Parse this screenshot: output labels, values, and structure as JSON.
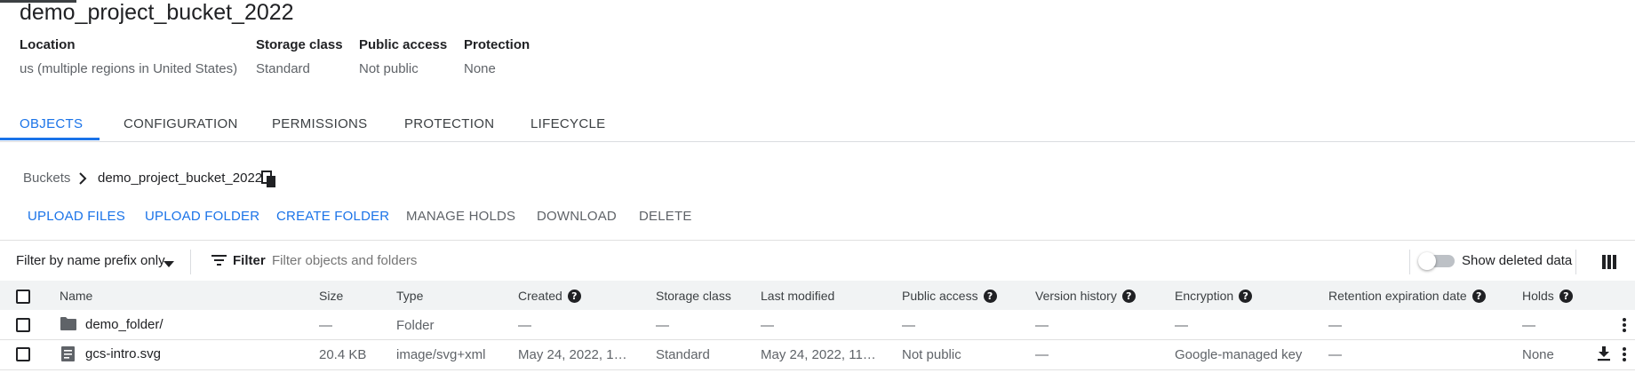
{
  "bucket": {
    "name": "demo_project_bucket_2022",
    "details": [
      {
        "label": "Location",
        "value": "us (multiple regions in United States)"
      },
      {
        "label": "Storage class",
        "value": "Standard"
      },
      {
        "label": "Public access",
        "value": "Not public"
      },
      {
        "label": "Protection",
        "value": "None"
      }
    ]
  },
  "tabs": [
    {
      "label": "OBJECTS",
      "active": true
    },
    {
      "label": "CONFIGURATION",
      "active": false
    },
    {
      "label": "PERMISSIONS",
      "active": false
    },
    {
      "label": "PROTECTION",
      "active": false
    },
    {
      "label": "LIFECYCLE",
      "active": false
    }
  ],
  "breadcrumb": {
    "root": "Buckets",
    "current": "demo_project_bucket_2022"
  },
  "actions": [
    {
      "label": "UPLOAD FILES",
      "enabled": true
    },
    {
      "label": "UPLOAD FOLDER",
      "enabled": true
    },
    {
      "label": "CREATE FOLDER",
      "enabled": true
    },
    {
      "label": "MANAGE HOLDS",
      "enabled": false
    },
    {
      "label": "DOWNLOAD",
      "enabled": false
    },
    {
      "label": "DELETE",
      "enabled": false
    }
  ],
  "filterbar": {
    "prefix_dropdown": "Filter by name prefix only",
    "filter_label": "Filter",
    "filter_placeholder": "Filter objects and folders",
    "show_deleted_label": "Show deleted data",
    "show_deleted_on": false
  },
  "table": {
    "columns": [
      "Name",
      "Size",
      "Type",
      "Created",
      "Storage class",
      "Last modified",
      "Public access",
      "Version history",
      "Encryption",
      "Retention expiration date",
      "Holds"
    ],
    "rows": [
      {
        "icon": "folder-icon",
        "name": "demo_folder/",
        "size": "—",
        "type": "Folder",
        "created": "—",
        "storage_class": "—",
        "last_modified": "—",
        "public_access": "—",
        "version_history": "—",
        "encryption": "—",
        "retention": "—",
        "holds": "—"
      },
      {
        "icon": "file-icon",
        "name": "gcs-intro.svg",
        "size": "20.4 KB",
        "type": "image/svg+xml",
        "created": "May 24, 2022, 1…",
        "storage_class": "Standard",
        "last_modified": "May 24, 2022, 11…",
        "public_access": "Not public",
        "version_history": "—",
        "encryption": "Google-managed key",
        "retention": "—",
        "holds": "None"
      }
    ]
  },
  "colors": {
    "accent": "#1a73e8",
    "header_bg": "#f1f3f4",
    "divider": "#dadce0"
  }
}
